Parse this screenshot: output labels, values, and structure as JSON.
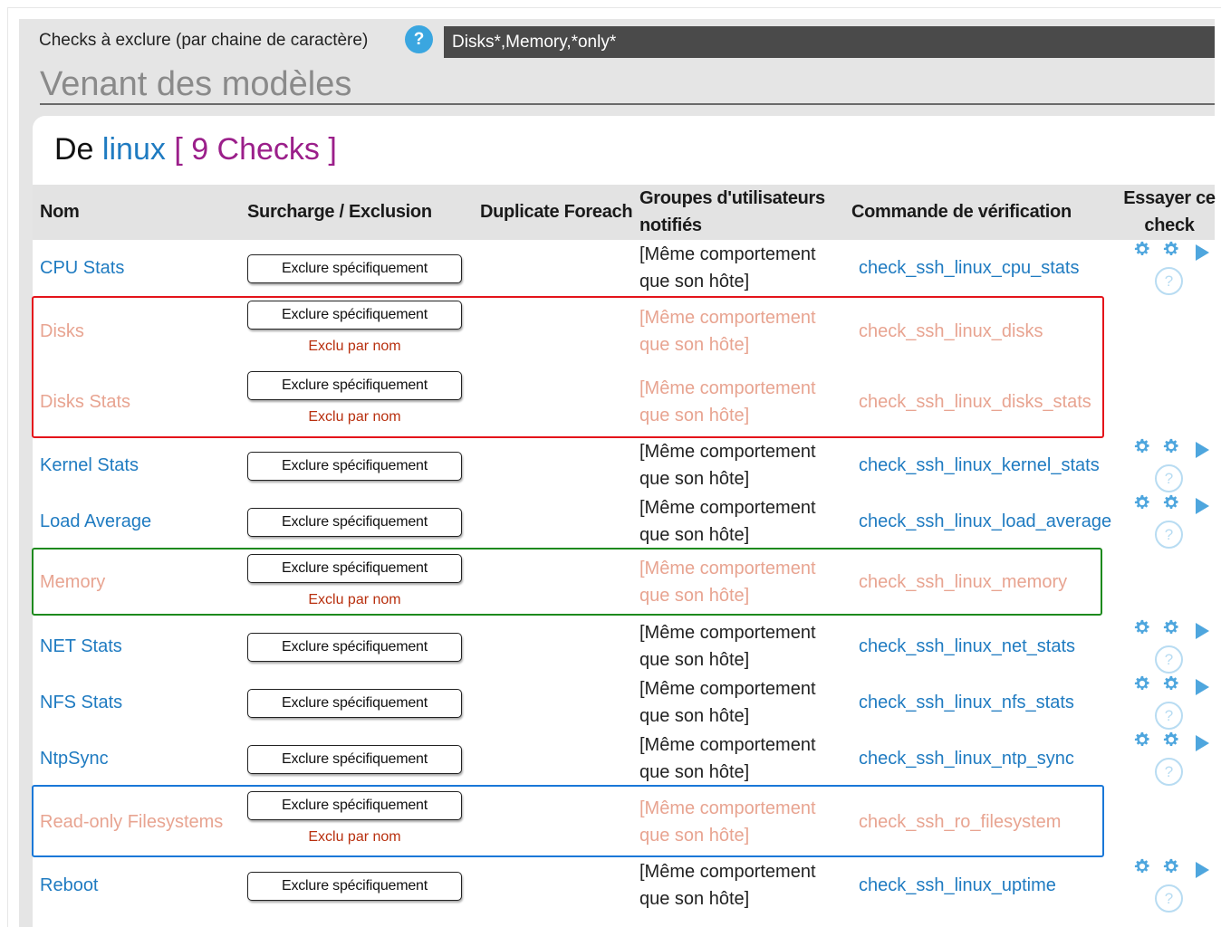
{
  "exclusion": {
    "label": "Checks à exclure (par chaine de caractère)",
    "help_label": "?",
    "value": "Disks*,Memory,*only*"
  },
  "section": {
    "title": "Venant des modèles"
  },
  "card": {
    "prefix": "De",
    "template": "linux",
    "count": "[ 9 Checks ]"
  },
  "table": {
    "headers": {
      "name": "Nom",
      "override": "Surcharge / Exclusion",
      "duplicate": "Duplicate Foreach",
      "groups": "Groupes d'utilisateurs notifiés",
      "command": "Commande de vérification",
      "try": "Essayer ce check"
    },
    "rows": [
      {
        "name": "CPU Stats",
        "button": "Exclure spécifiquement",
        "notif": "[Même comportement que son hôte]",
        "command": "check_ssh_linux_cpu_stats",
        "excluded": false
      },
      {
        "name": "Disks",
        "button": "Exclure spécifiquement",
        "note": "Exclu par nom",
        "notif": "[Même comportement que son hôte]",
        "command": "check_ssh_linux_disks",
        "excluded": true
      },
      {
        "name": "Disks Stats",
        "button": "Exclure spécifiquement",
        "note": "Exclu par nom",
        "notif": "[Même comportement que son hôte]",
        "command": "check_ssh_linux_disks_stats",
        "excluded": true
      },
      {
        "name": "Kernel Stats",
        "button": "Exclure spécifiquement",
        "notif": "[Même comportement que son hôte]",
        "command": "check_ssh_linux_kernel_stats",
        "excluded": false
      },
      {
        "name": "Load Average",
        "button": "Exclure spécifiquement",
        "notif": "[Même comportement que son hôte]",
        "command": "check_ssh_linux_load_average",
        "excluded": false
      },
      {
        "name": "Memory",
        "button": "Exclure spécifiquement",
        "note": "Exclu par nom",
        "notif": "[Même comportement que son hôte]",
        "command": "check_ssh_linux_memory",
        "excluded": true
      },
      {
        "name": "NET Stats",
        "button": "Exclure spécifiquement",
        "notif": "[Même comportement que son hôte]",
        "command": "check_ssh_linux_net_stats",
        "excluded": false
      },
      {
        "name": "NFS Stats",
        "button": "Exclure spécifiquement",
        "notif": "[Même comportement que son hôte]",
        "command": "check_ssh_linux_nfs_stats",
        "excluded": false
      },
      {
        "name": "NtpSync",
        "button": "Exclure spécifiquement",
        "notif": "[Même comportement que son hôte]",
        "command": "check_ssh_linux_ntp_sync",
        "excluded": false
      },
      {
        "name": "Read-only Filesystems",
        "button": "Exclure spécifiquement",
        "note": "Exclu par nom",
        "notif": "[Même comportement que son hôte]",
        "command": "check_ssh_ro_filesystem",
        "excluded": true
      },
      {
        "name": "Reboot",
        "button": "Exclure spécifiquement",
        "notif": "[Même comportement que son hôte]",
        "command": "check_ssh_linux_uptime",
        "excluded": false
      }
    ],
    "action_icons": [
      "gear-icon",
      "gears-icon",
      "play-icon",
      "help-icon"
    ]
  },
  "colors": {
    "link": "#1f7bc1",
    "excluded_text": "#e8a491",
    "excluded_note": "#b8300f",
    "count": "#9b1f8a",
    "highlight_disks": "#e4141b",
    "highlight_memory": "#1e8a1e",
    "highlight_readonly": "#1a78d8"
  }
}
